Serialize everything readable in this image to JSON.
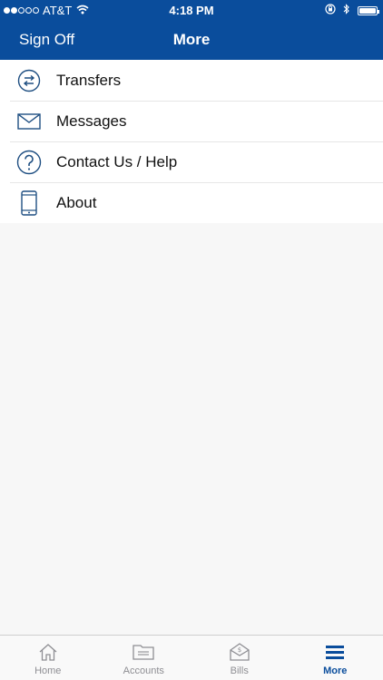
{
  "status_bar": {
    "carrier": "AT&T",
    "time": "4:18 PM"
  },
  "nav": {
    "left_button": "Sign Off",
    "title": "More"
  },
  "menu": {
    "items": [
      {
        "label": "Transfers",
        "icon": "transfer-arrows-icon"
      },
      {
        "label": "Messages",
        "icon": "envelope-icon"
      },
      {
        "label": "Contact Us / Help",
        "icon": "question-circle-icon"
      },
      {
        "label": "About",
        "icon": "tablet-device-icon"
      }
    ]
  },
  "tab_bar": {
    "tabs": [
      {
        "label": "Home",
        "icon": "house-icon"
      },
      {
        "label": "Accounts",
        "icon": "folder-icon"
      },
      {
        "label": "Bills",
        "icon": "bill-envelope-icon"
      },
      {
        "label": "More",
        "icon": "hamburger-menu-icon",
        "active": true
      }
    ]
  },
  "colors": {
    "brand_blue": "#0a4d9c",
    "icon_blue": "#1f4f82",
    "tab_inactive": "#8e8e93",
    "background": "#f7f7f7"
  }
}
